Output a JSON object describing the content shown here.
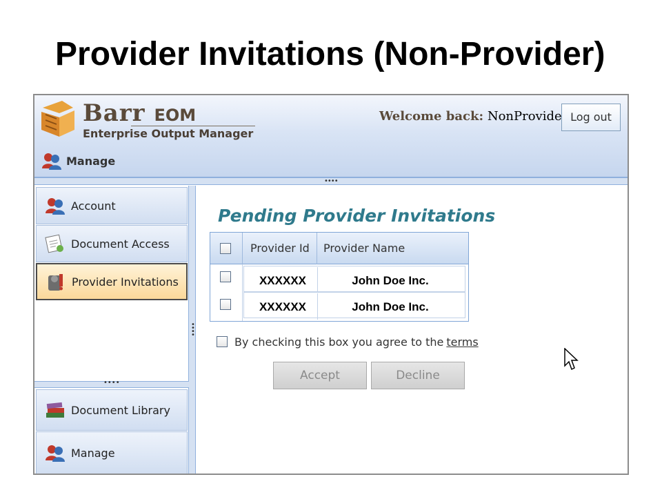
{
  "slide": {
    "title": "Provider Invitations (Non-Provider)"
  },
  "header": {
    "brand": "Barr",
    "brand_suffix": "EOM",
    "brand_sub": "Enterprise Output Manager",
    "manage_label": "Manage",
    "welcome_prefix": "Welcome back:",
    "username": "NonProvider",
    "logout_label": "Log out"
  },
  "sidebar": {
    "items": [
      {
        "label": "Account",
        "icon": "users-icon"
      },
      {
        "label": "Document Access",
        "icon": "document-access-icon"
      },
      {
        "label": "Provider Invitations",
        "icon": "provider-invitations-icon",
        "selected": true
      }
    ],
    "bottom_items": [
      {
        "label": "Document Library",
        "icon": "books-icon"
      },
      {
        "label": "Manage",
        "icon": "users-icon"
      }
    ]
  },
  "main": {
    "title": "Pending Provider Invitations",
    "table": {
      "columns": [
        "Provider Id",
        "Provider Name"
      ],
      "rows": [
        {
          "id": "XXXXXX",
          "name": "John Doe Inc.",
          "checked": false
        },
        {
          "id": "XXXXXX",
          "name": "John Doe Inc.",
          "checked": false
        }
      ]
    },
    "terms_text": "By checking this box you agree to the",
    "terms_link": "terms",
    "accept_label": "Accept",
    "decline_label": "Decline"
  },
  "colors": {
    "header_bg": "#c6d6ee",
    "selected_nav": "#fbd89a",
    "title_teal": "#2f7a8c",
    "border_blue": "#7fa5d6"
  }
}
